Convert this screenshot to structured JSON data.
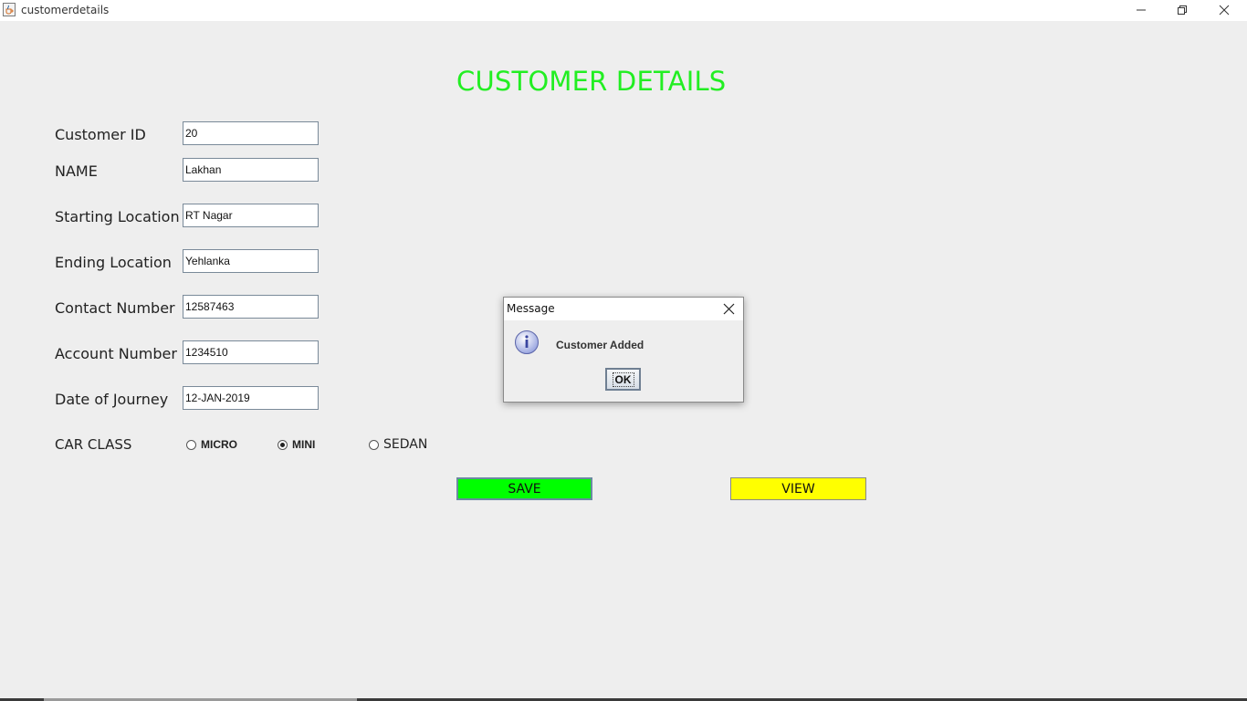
{
  "window": {
    "title": "customerdetails",
    "icon": "java-cup-icon",
    "controls": [
      "minimize-icon",
      "restore-icon",
      "close-icon"
    ]
  },
  "form": {
    "heading": "CUSTOMER DETAILS",
    "heading_color": "#22ee22",
    "fields": [
      {
        "label": "Customer ID",
        "value": "20"
      },
      {
        "label": "NAME",
        "value": "Lakhan"
      },
      {
        "label": "Starting Location",
        "value": "RT Nagar"
      },
      {
        "label": "Ending Location",
        "value": "Yehlanka"
      },
      {
        "label": "Contact Number",
        "value": "12587463"
      },
      {
        "label": "Account Number",
        "value": "1234510"
      },
      {
        "label": "Date of Journey",
        "value": "12-JAN-2019"
      }
    ],
    "car_class": {
      "label": "CAR CLASS",
      "options": [
        "MICRO",
        "MINI",
        "SEDAN"
      ],
      "selected": "MINI"
    },
    "buttons": {
      "save": "SAVE",
      "save_color": "#00ff00",
      "view": "VIEW",
      "view_color": "#ffff00"
    }
  },
  "dialog": {
    "title": "Message",
    "message": "Customer Added",
    "ok": "OK",
    "icon": "info-icon"
  }
}
